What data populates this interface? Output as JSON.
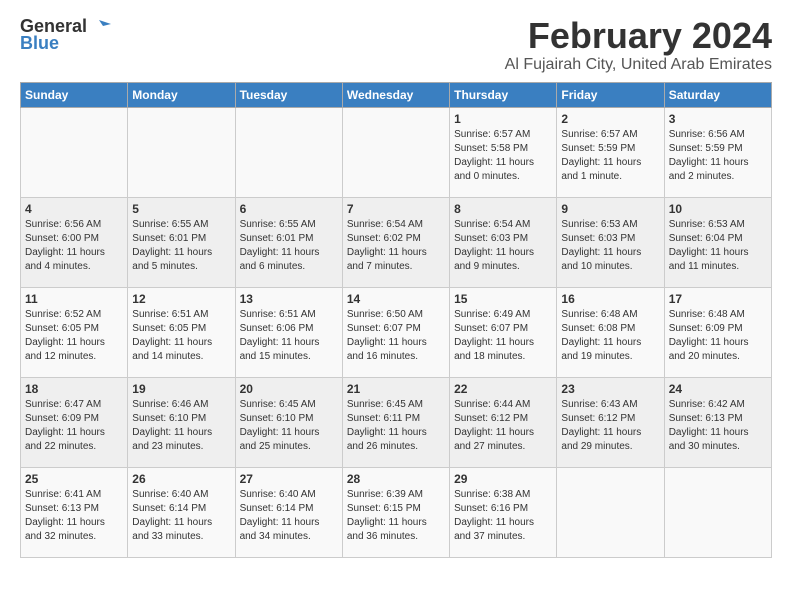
{
  "logo": {
    "general": "General",
    "blue": "Blue"
  },
  "title": "February 2024",
  "location": "Al Fujairah City, United Arab Emirates",
  "weekdays": [
    "Sunday",
    "Monday",
    "Tuesday",
    "Wednesday",
    "Thursday",
    "Friday",
    "Saturday"
  ],
  "weeks": [
    [
      {
        "day": "",
        "info": ""
      },
      {
        "day": "",
        "info": ""
      },
      {
        "day": "",
        "info": ""
      },
      {
        "day": "",
        "info": ""
      },
      {
        "day": "1",
        "info": "Sunrise: 6:57 AM\nSunset: 5:58 PM\nDaylight: 11 hours\nand 0 minutes."
      },
      {
        "day": "2",
        "info": "Sunrise: 6:57 AM\nSunset: 5:59 PM\nDaylight: 11 hours\nand 1 minute."
      },
      {
        "day": "3",
        "info": "Sunrise: 6:56 AM\nSunset: 5:59 PM\nDaylight: 11 hours\nand 2 minutes."
      }
    ],
    [
      {
        "day": "4",
        "info": "Sunrise: 6:56 AM\nSunset: 6:00 PM\nDaylight: 11 hours\nand 4 minutes."
      },
      {
        "day": "5",
        "info": "Sunrise: 6:55 AM\nSunset: 6:01 PM\nDaylight: 11 hours\nand 5 minutes."
      },
      {
        "day": "6",
        "info": "Sunrise: 6:55 AM\nSunset: 6:01 PM\nDaylight: 11 hours\nand 6 minutes."
      },
      {
        "day": "7",
        "info": "Sunrise: 6:54 AM\nSunset: 6:02 PM\nDaylight: 11 hours\nand 7 minutes."
      },
      {
        "day": "8",
        "info": "Sunrise: 6:54 AM\nSunset: 6:03 PM\nDaylight: 11 hours\nand 9 minutes."
      },
      {
        "day": "9",
        "info": "Sunrise: 6:53 AM\nSunset: 6:03 PM\nDaylight: 11 hours\nand 10 minutes."
      },
      {
        "day": "10",
        "info": "Sunrise: 6:53 AM\nSunset: 6:04 PM\nDaylight: 11 hours\nand 11 minutes."
      }
    ],
    [
      {
        "day": "11",
        "info": "Sunrise: 6:52 AM\nSunset: 6:05 PM\nDaylight: 11 hours\nand 12 minutes."
      },
      {
        "day": "12",
        "info": "Sunrise: 6:51 AM\nSunset: 6:05 PM\nDaylight: 11 hours\nand 14 minutes."
      },
      {
        "day": "13",
        "info": "Sunrise: 6:51 AM\nSunset: 6:06 PM\nDaylight: 11 hours\nand 15 minutes."
      },
      {
        "day": "14",
        "info": "Sunrise: 6:50 AM\nSunset: 6:07 PM\nDaylight: 11 hours\nand 16 minutes."
      },
      {
        "day": "15",
        "info": "Sunrise: 6:49 AM\nSunset: 6:07 PM\nDaylight: 11 hours\nand 18 minutes."
      },
      {
        "day": "16",
        "info": "Sunrise: 6:48 AM\nSunset: 6:08 PM\nDaylight: 11 hours\nand 19 minutes."
      },
      {
        "day": "17",
        "info": "Sunrise: 6:48 AM\nSunset: 6:09 PM\nDaylight: 11 hours\nand 20 minutes."
      }
    ],
    [
      {
        "day": "18",
        "info": "Sunrise: 6:47 AM\nSunset: 6:09 PM\nDaylight: 11 hours\nand 22 minutes."
      },
      {
        "day": "19",
        "info": "Sunrise: 6:46 AM\nSunset: 6:10 PM\nDaylight: 11 hours\nand 23 minutes."
      },
      {
        "day": "20",
        "info": "Sunrise: 6:45 AM\nSunset: 6:10 PM\nDaylight: 11 hours\nand 25 minutes."
      },
      {
        "day": "21",
        "info": "Sunrise: 6:45 AM\nSunset: 6:11 PM\nDaylight: 11 hours\nand 26 minutes."
      },
      {
        "day": "22",
        "info": "Sunrise: 6:44 AM\nSunset: 6:12 PM\nDaylight: 11 hours\nand 27 minutes."
      },
      {
        "day": "23",
        "info": "Sunrise: 6:43 AM\nSunset: 6:12 PM\nDaylight: 11 hours\nand 29 minutes."
      },
      {
        "day": "24",
        "info": "Sunrise: 6:42 AM\nSunset: 6:13 PM\nDaylight: 11 hours\nand 30 minutes."
      }
    ],
    [
      {
        "day": "25",
        "info": "Sunrise: 6:41 AM\nSunset: 6:13 PM\nDaylight: 11 hours\nand 32 minutes."
      },
      {
        "day": "26",
        "info": "Sunrise: 6:40 AM\nSunset: 6:14 PM\nDaylight: 11 hours\nand 33 minutes."
      },
      {
        "day": "27",
        "info": "Sunrise: 6:40 AM\nSunset: 6:14 PM\nDaylight: 11 hours\nand 34 minutes."
      },
      {
        "day": "28",
        "info": "Sunrise: 6:39 AM\nSunset: 6:15 PM\nDaylight: 11 hours\nand 36 minutes."
      },
      {
        "day": "29",
        "info": "Sunrise: 6:38 AM\nSunset: 6:16 PM\nDaylight: 11 hours\nand 37 minutes."
      },
      {
        "day": "",
        "info": ""
      },
      {
        "day": "",
        "info": ""
      }
    ]
  ]
}
